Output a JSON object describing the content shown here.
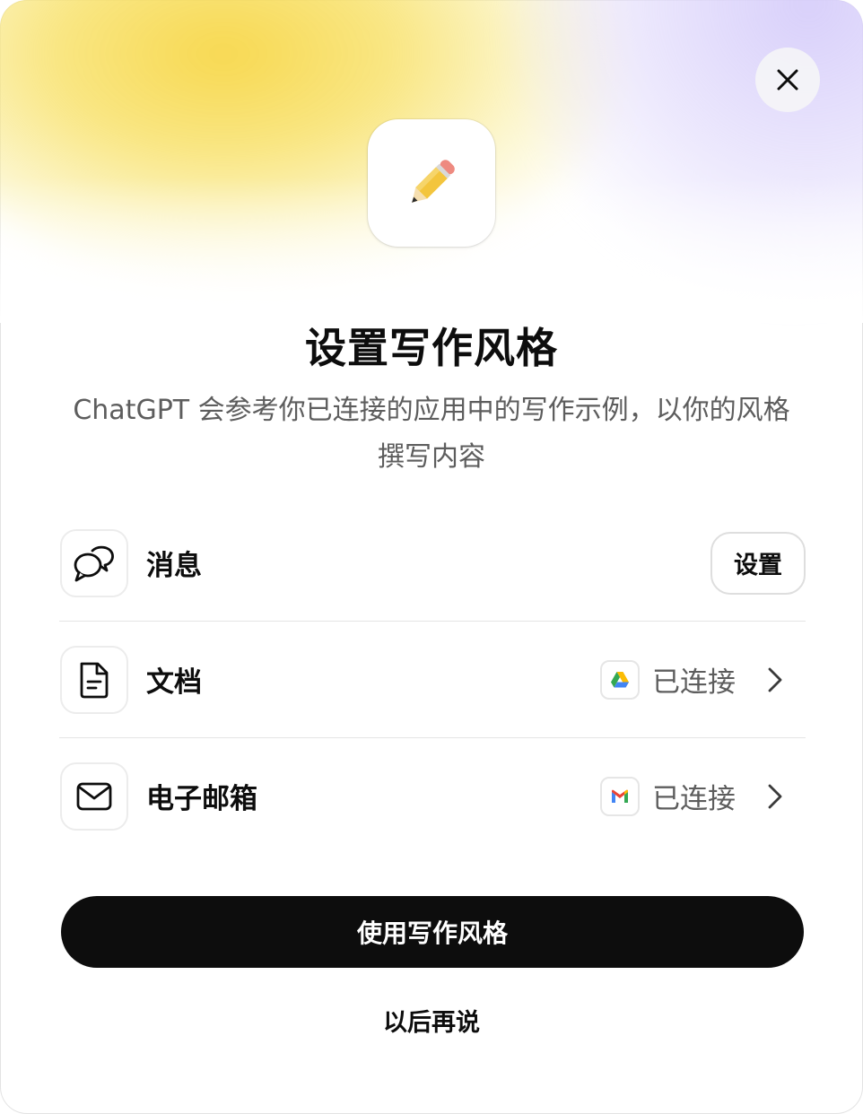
{
  "dialog": {
    "title": "设置写作风格",
    "subtitle": "ChatGPT 会参考你已连接的应用中的写作示例，以你的风格撰写内容",
    "close_icon": "close-icon",
    "app_icon": "pencil-icon"
  },
  "sources": [
    {
      "label": "消息",
      "icon": "chat-bubbles-icon",
      "action_label": "设置"
    },
    {
      "label": "文档",
      "icon": "document-icon",
      "service_icon": "google-drive-icon",
      "status": "已连接",
      "chevron": "chevron-right-icon"
    },
    {
      "label": "电子邮箱",
      "icon": "mail-icon",
      "service_icon": "gmail-icon",
      "status": "已连接",
      "chevron": "chevron-right-icon"
    }
  ],
  "actions": {
    "primary_label": "使用写作风格",
    "secondary_label": "以后再说"
  },
  "colors": {
    "primary_button": "#0d0d0d",
    "text_muted": "#5d5d5d",
    "gradient_yellow": "#f7d646",
    "gradient_lilac": "#d6cdfa"
  }
}
